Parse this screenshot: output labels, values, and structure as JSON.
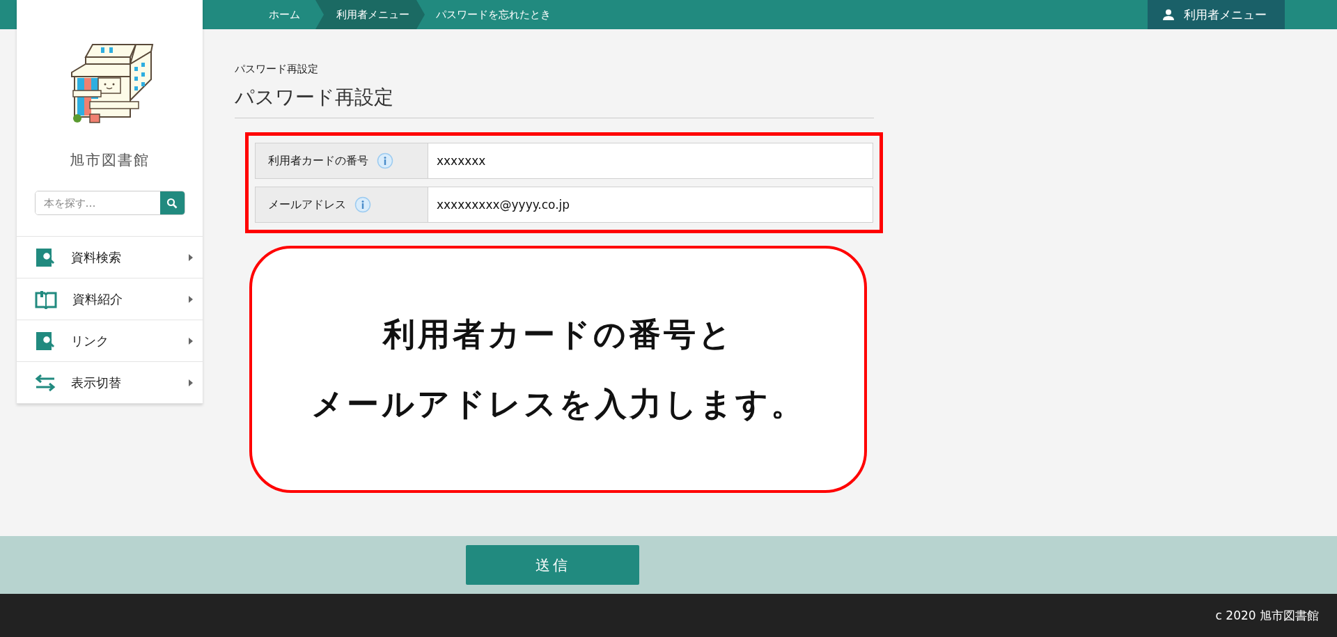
{
  "breadcrumb": [
    {
      "label": "ホーム",
      "highlighted": false
    },
    {
      "label": "利用者メニュー",
      "highlighted": true
    },
    {
      "label": "パスワードを忘れたとき",
      "highlighted": false
    }
  ],
  "user_menu": {
    "label": "利用者メニュー"
  },
  "sidebar": {
    "library_name": "旭市図書館",
    "search": {
      "placeholder": "本を探す…"
    },
    "items": [
      {
        "label": "資料検索",
        "kind": "search"
      },
      {
        "label": "資料紹介",
        "kind": "book"
      },
      {
        "label": "リンク",
        "kind": "search"
      },
      {
        "label": "表示切替",
        "kind": "swap"
      }
    ]
  },
  "page": {
    "subtitle": "パスワード再設定",
    "title": "パスワード再設定"
  },
  "form": {
    "fields": [
      {
        "label": "利用者カードの番号",
        "value": "xxxxxxx"
      },
      {
        "label": "メールアドレス",
        "value": "xxxxxxxxx@yyyy.co.jp"
      }
    ]
  },
  "callout": {
    "lines": [
      "利用者カードの番号と",
      "メールアドレスを入力します。"
    ]
  },
  "submit": {
    "label": "送信"
  },
  "footer": {
    "copyright": "c 2020 旭市図書館"
  }
}
